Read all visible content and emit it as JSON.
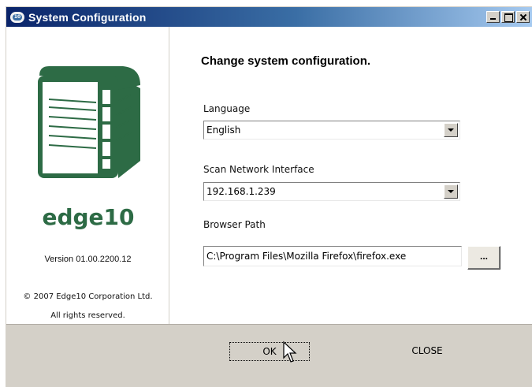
{
  "window": {
    "title": "System Configuration",
    "icon": "edge10-app-icon",
    "title_bar_colors": [
      "#0a246a",
      "#3a6ea5",
      "#a6caf0"
    ],
    "controls": [
      "minimize-icon",
      "maximize-icon",
      "close-icon"
    ]
  },
  "sidebar": {
    "logo_icon": "server-storage-icon",
    "brand_text": "edge10",
    "brand_color": "#2d6b45",
    "version": "Version 01.00.2200.12",
    "copyright": "© 2007 Edge10 Corporation Ltd.",
    "rights": "All rights reserved."
  },
  "main": {
    "heading": "Change system configuration.",
    "language": {
      "label": "Language",
      "selected": "English"
    },
    "network": {
      "label": "Scan Network Interface",
      "selected": "192.168.1.239"
    },
    "browser": {
      "label": "Browser Path",
      "value": "C:\\Program Files\\Mozilla Firefox\\firefox.exe",
      "browse_label": "..."
    }
  },
  "footer": {
    "ok_label": "OK",
    "close_label": "CLOSE"
  }
}
